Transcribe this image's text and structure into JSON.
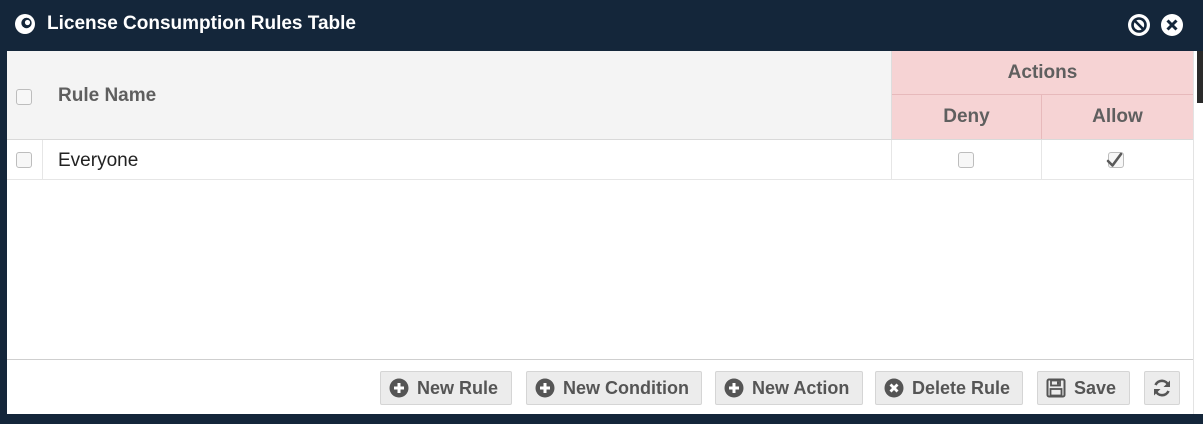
{
  "window": {
    "title": "License Consumption Rules Table",
    "title_icon": "swirl-logo-icon",
    "controls": [
      "minimize-circle-icon",
      "close-circle-icon"
    ]
  },
  "table": {
    "columns": {
      "rule_name": "Rule Name",
      "actions_group": "Actions",
      "deny": "Deny",
      "allow": "Allow"
    },
    "rows": [
      {
        "rule_name": "Everyone",
        "selected": false,
        "deny": false,
        "allow": true
      }
    ]
  },
  "toolbar": {
    "new_rule": "New Rule",
    "new_condition": "New Condition",
    "new_action": "New Action",
    "delete_rule": "Delete Rule",
    "save": "Save",
    "refresh_icon": "refresh-icon"
  },
  "colors": {
    "titlebar": "#14263a",
    "actions_header": "#f6d3d4",
    "header_bg": "#f4f4f4",
    "button_bg": "#ececec",
    "icon_dark": "#555555"
  }
}
